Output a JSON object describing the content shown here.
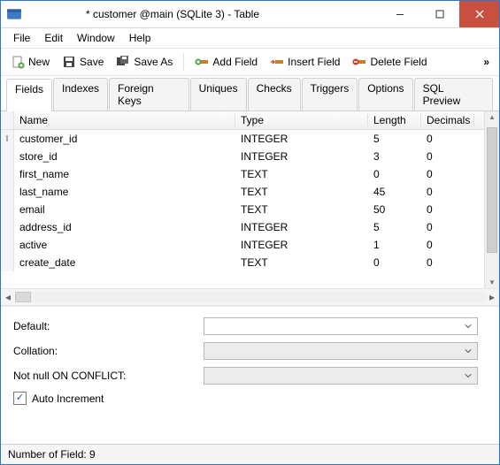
{
  "window": {
    "title": "* customer @main (SQLite 3) - Table"
  },
  "menu": {
    "items": [
      "File",
      "Edit",
      "Window",
      "Help"
    ]
  },
  "toolbar": {
    "new": "New",
    "save": "Save",
    "saveAs": "Save As",
    "addField": "Add Field",
    "insertField": "Insert Field",
    "deleteField": "Delete Field"
  },
  "tabs": {
    "items": [
      "Fields",
      "Indexes",
      "Foreign Keys",
      "Uniques",
      "Checks",
      "Triggers",
      "Options",
      "SQL Preview"
    ],
    "active": 0
  },
  "columns": {
    "name": "Name",
    "type": "Type",
    "length": "Length",
    "decimals": "Decimals"
  },
  "rows": [
    {
      "name": "customer_id",
      "type": "INTEGER",
      "length": "5",
      "decimals": "0"
    },
    {
      "name": "store_id",
      "type": "INTEGER",
      "length": "3",
      "decimals": "0"
    },
    {
      "name": "first_name",
      "type": "TEXT",
      "length": "0",
      "decimals": "0"
    },
    {
      "name": "last_name",
      "type": "TEXT",
      "length": "45",
      "decimals": "0"
    },
    {
      "name": "email",
      "type": "TEXT",
      "length": "50",
      "decimals": "0"
    },
    {
      "name": "address_id",
      "type": "INTEGER",
      "length": "5",
      "decimals": "0"
    },
    {
      "name": "active",
      "type": "INTEGER",
      "length": "1",
      "decimals": "0"
    },
    {
      "name": "create_date",
      "type": "TEXT",
      "length": "0",
      "decimals": "0"
    }
  ],
  "form": {
    "defaultLabel": "Default:",
    "collationLabel": "Collation:",
    "notNullLabel": "Not null ON CONFLICT:",
    "autoIncLabel": "Auto Increment",
    "autoIncChecked": true,
    "defaultValue": "",
    "collationValue": "",
    "notNullValue": ""
  },
  "status": {
    "text": "Number of Field: 9"
  }
}
